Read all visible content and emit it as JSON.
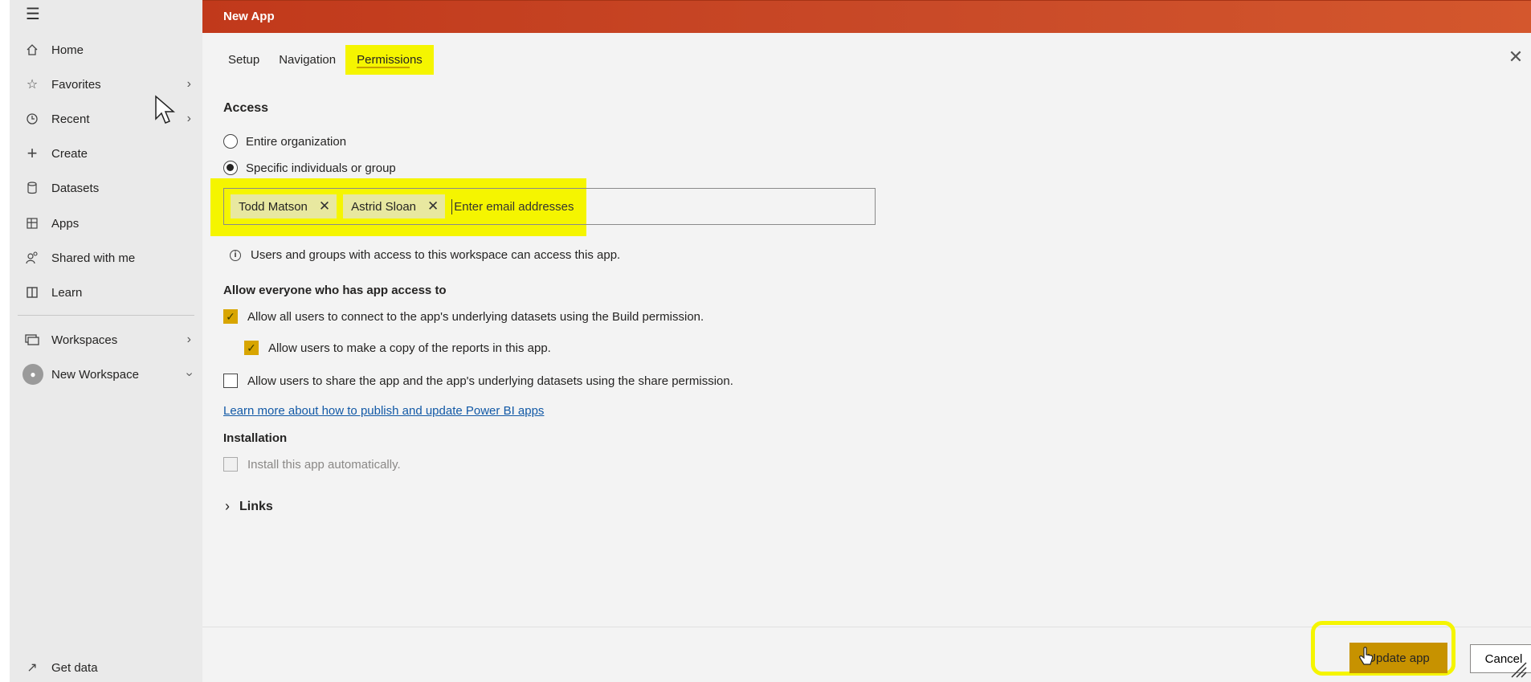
{
  "sidebar": {
    "items": [
      {
        "label": "Home",
        "icon": "home-icon"
      },
      {
        "label": "Favorites",
        "icon": "star-icon"
      },
      {
        "label": "Recent",
        "icon": "clock-icon"
      },
      {
        "label": "Create",
        "icon": "plus-icon"
      },
      {
        "label": "Datasets",
        "icon": "database-icon"
      },
      {
        "label": "Apps",
        "icon": "apps-icon"
      },
      {
        "label": "Shared with me",
        "icon": "shared-icon"
      },
      {
        "label": "Learn",
        "icon": "book-icon"
      }
    ],
    "workspaces_label": "Workspaces",
    "current_workspace": "New Workspace",
    "get_data_label": "Get data"
  },
  "dialog": {
    "title": "New App",
    "tabs": [
      "Setup",
      "Navigation",
      "Permissions"
    ],
    "active_tab": "Permissions",
    "access": {
      "heading": "Access",
      "option_entire": "Entire organization",
      "option_specific": "Specific individuals or group",
      "selected": "Specific individuals or group",
      "chips": [
        "Todd Matson",
        "Astrid Sloan"
      ],
      "email_placeholder": "Enter email addresses",
      "info_text": "Users and groups with access to this workspace can access this app."
    },
    "allow": {
      "heading": "Allow everyone who has app access to",
      "build_permission": "Allow all users to connect to the app's underlying datasets using the Build permission.",
      "copy_reports": "Allow users to make a copy of the reports in this app.",
      "share_permission": "Allow users to share the app and the app's underlying datasets using the share permission.",
      "build_checked": true,
      "copy_checked": true,
      "share_checked": false
    },
    "learn_link": "Learn more about how to publish and update Power BI apps",
    "installation": {
      "heading": "Installation",
      "auto_install": "Install this app automatically."
    },
    "links_label": "Links",
    "update_button": "Update app",
    "cancel_button": "Cancel"
  },
  "colors": {
    "titlebar": "#c1391b",
    "highlight": "#f5f500",
    "checkbox_on": "#d8a500",
    "link": "#1259a6"
  }
}
